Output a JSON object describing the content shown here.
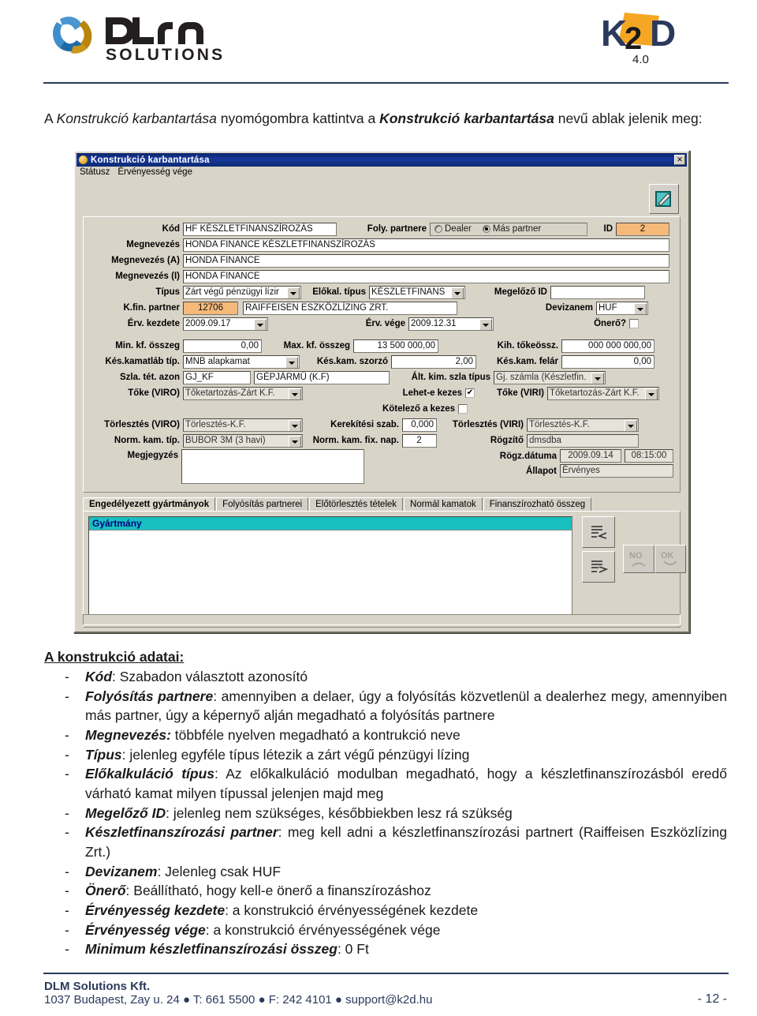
{
  "header": {
    "logo_left": "DLM SOLUTIONS",
    "logo_left_line1": "DLM",
    "logo_left_line2": "SOLUTIONS",
    "logo_right": "K2D",
    "logo_right_version": "4.0"
  },
  "intro": {
    "part1": "A ",
    "italic1": "Konstrukció karbantartása",
    "part2": " nyomógombra kattintva a ",
    "bold1": "Konstrukció karbantartása",
    "part3": " nevű ablak jelenik meg:"
  },
  "dialog": {
    "title": "Konstrukció karbantartása",
    "close_label": "✕",
    "menu": [
      "Státusz",
      "Érvényesség vége"
    ],
    "fields": {
      "kod_label": "Kód",
      "kod_value": "HF KÉSZLETFINANSZÍROZÁS",
      "foly_partnere_label": "Foly. partnere",
      "radio_dealer": "Dealer",
      "radio_mas_partner": "Más partner",
      "radio_selected": "Más partner",
      "id_label": "ID",
      "id_value": "2",
      "megnevezes_label": "Megnevezés",
      "megnevezes_value": "HONDA FINANCE KÉSZLETFINANSZÍROZÁS",
      "megnevezes_a_label": "Megnevezés (A)",
      "megnevezes_a_value": "HONDA FINANCE",
      "megnevezes_i_label": "Megnevezés (I)",
      "megnevezes_i_value": "HONDA FINANCE",
      "tipus_label": "Típus",
      "tipus_value": "Zárt végű pénzügyi lízir",
      "elokal_tipus_label": "Előkal. típus",
      "elokal_tipus_value": "KÉSZLETFINANS",
      "megelozo_id_label": "Megelőző ID",
      "megelozo_id_value": "",
      "kfin_partner_label": "K.fin. partner",
      "kfin_partner_id": "12706",
      "kfin_partner_name": "RAIFFEISEN ESZKÖZLÍZING ZRT.",
      "devizanem_label": "Devizanem",
      "devizanem_value": "HUF",
      "erv_kezdete_label": "Érv. kezdete",
      "erv_kezdete_value": "2009.09.17",
      "erv_vege_label": "Érv. vége",
      "erv_vege_value": "2009.12.31",
      "onero_label": "Önerő?",
      "onero_checked": false,
      "min_kf_osszeg_label": "Min. kf. összeg",
      "min_kf_osszeg_value": "0,00",
      "max_kf_osszeg_label": "Max. kf. összeg",
      "max_kf_osszeg_value": "13 500 000,00",
      "kih_tokeossz_label": "Kih. tőkeössz.",
      "kih_tokeossz_value": "000 000 000,00",
      "kes_kamatlab_tip_label": "Kés.kamatláb típ.",
      "kes_kamatlab_tip_value": "MNB alapkamat",
      "kes_kam_szorzo_label": "Kés.kam. szorzó",
      "kes_kam_szorzo_value": "2,00",
      "kes_kam_felar_label": "Kés.kam. felár",
      "kes_kam_felar_value": "0,00",
      "szla_tet_azon_label": "Szla. tét. azon",
      "szla_tet_azon_value": "GJ_KF",
      "szla_tet_azon_name": "GÉPJÁRMŰ (K.F)",
      "alt_kim_szla_tipus_label": "Ált. kim. szla típus",
      "alt_kim_szla_tipus_value": "Gj. számla (Készletfin.",
      "toke_viro_label": "Tőke  (VIRO)",
      "toke_viro_value": "Tőketartozás-Zárt K.F.",
      "lehet_e_kezes_label": "Lehet-e kezes",
      "lehet_e_kezes_checked": true,
      "toke_viri_label": "Tőke (VIRI)",
      "toke_viri_value": "Tőketartozás-Zárt K.F.",
      "kotelezo_a_kezes_label": "Kötelező a kezes",
      "kotelezo_a_kezes_checked": false,
      "torlesztes_viro_label": "Törlesztés (VIRO)",
      "torlesztes_viro_value": "Törlesztés-K.F.",
      "kerekitesi_szab_label": "Kerekítési szab.",
      "kerekitesi_szab_value": "0,000",
      "torlesztes_viri_label": "Törlesztés (VIRI)",
      "torlesztes_viri_value": "Törlesztés-K.F.",
      "norm_kam_tip_label": "Norm. kam. típ.",
      "norm_kam_tip_value": "BUBOR 3M (3 havi)",
      "norm_kam_fix_nap_label": "Norm. kam. fix. nap.",
      "norm_kam_fix_nap_value": "2",
      "rogzito_label": "Rögzítő",
      "rogzito_value": "dmsdba",
      "megjegyzes_label": "Megjegyzés",
      "megjegyzes_value": "",
      "rogz_datuma_label": "Rögz.dátuma",
      "rogz_datuma_value": "2009.09.14",
      "rogz_ido_value": "08:15:00",
      "allapot_label": "Állapot",
      "allapot_value": "Érvényes"
    },
    "tabs": [
      "Engedélyezett gyártmányok",
      "Folyósítás partnerei",
      "Előtörlesztés tételek",
      "Normál kamatok",
      "Finanszírozható összeg"
    ],
    "active_tab": "Engedélyezett gyártmányok",
    "grid_header": "Gyártmány",
    "action_no": "NO",
    "action_ok": "OK"
  },
  "content": {
    "heading": "A konstrukció adatai:",
    "items": [
      {
        "term": "Kód",
        "sep": ": ",
        "desc": "Szabadon választott azonosító"
      },
      {
        "term": "Folyósítás partnere",
        "sep": ": ",
        "desc": "amennyiben a delaer, úgy a folyósítás közvetlenül a dealerhez megy, amennyiben más partner, úgy a képernyő alján megadható a folyósítás partnere"
      },
      {
        "term": "Megnevezés:",
        "sep": " ",
        "desc": "többféle nyelven megadható a kontrukció neve"
      },
      {
        "term": "Típus",
        "sep": ": ",
        "desc": "jelenleg egyféle típus létezik a zárt végű pénzügyi lízing"
      },
      {
        "term": "Előkalkuláció típus",
        "sep": ": ",
        "desc": "Az előkalkuláció modulban megadható, hogy a készletfinanszírozásból eredő várható kamat milyen típussal jelenjen majd meg"
      },
      {
        "term": "Megelőző ID",
        "sep": ": ",
        "desc": "jelenleg nem szükséges, későbbiekben lesz rá szükség"
      },
      {
        "term": "Készletfinanszírozási partner",
        "sep": ": ",
        "desc": "meg kell adni a készletfinanszírozási partnert (Raiffeisen Eszközlízing Zrt.)"
      },
      {
        "term": "Devizanem",
        "sep": ": ",
        "desc": "Jelenleg csak HUF"
      },
      {
        "term": "Önerő",
        "sep": ": ",
        "desc": "Beállítható, hogy kell-e önerő a finanszírozáshoz"
      },
      {
        "term": "Érvényesség kezdete",
        "sep": ": ",
        "desc": "a konstrukció érvényességének kezdete"
      },
      {
        "term": "Érvényesség vége",
        "sep": ": ",
        "desc": "a konstrukció érvényességének vége"
      },
      {
        "term": "Minimum készletfinanszírozási összeg",
        "sep": ": ",
        "desc": "0 Ft"
      }
    ],
    "dash": "-"
  },
  "footer": {
    "company": "DLM Solutions Kft.",
    "address": "1037 Budapest, Zay u. 24  ● T: 661 5500 ● F: 242 4101 ● support@k2d.hu",
    "page": "- 12 -"
  }
}
